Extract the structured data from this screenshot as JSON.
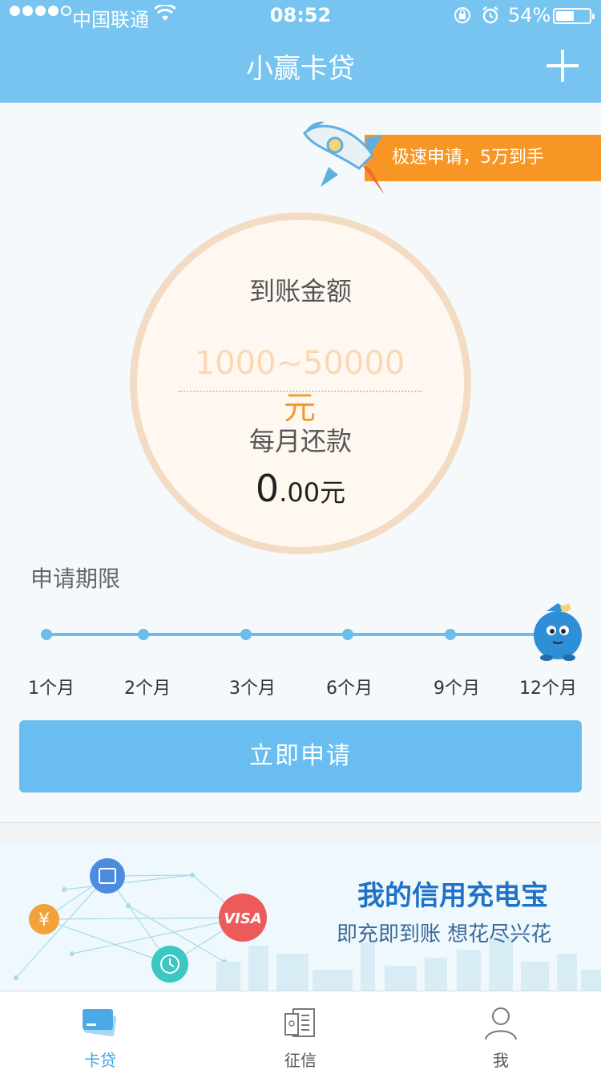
{
  "status_bar": {
    "carrier": "中国联通",
    "time": "08:52",
    "battery": "54%",
    "battery_level": 0.54
  },
  "nav": {
    "title": "小赢卡贷"
  },
  "promo": {
    "text": "极速申请，5万到手"
  },
  "amount_panel": {
    "amount_label": "到账金额",
    "amount_placeholder": "1000~50000",
    "amount_unit": "元",
    "monthly_label": "每月还款",
    "monthly_integer": "0",
    "monthly_decimal": ".00",
    "monthly_unit": "元"
  },
  "period": {
    "label": "申请期限",
    "options": [
      "1个月",
      "2个月",
      "3个月",
      "6个月",
      "9个月",
      "12个月"
    ],
    "selected": "12个月"
  },
  "apply_button": "立即申请",
  "ad_banner": {
    "title": "我的信用充电宝",
    "subtitle": "即充即到账  想花尽兴花",
    "visa_text": "VISA",
    "yen_text": "¥"
  },
  "tabs": [
    {
      "label": "卡贷",
      "icon": "card-icon",
      "active": true
    },
    {
      "label": "征信",
      "icon": "credit-report-icon",
      "active": false
    },
    {
      "label": "我",
      "icon": "user-icon",
      "active": false
    }
  ],
  "colors": {
    "header": "#76c4ef",
    "promo": "#f79624",
    "accent": "#69bdf0",
    "amount_unit": "#f29a2e"
  }
}
